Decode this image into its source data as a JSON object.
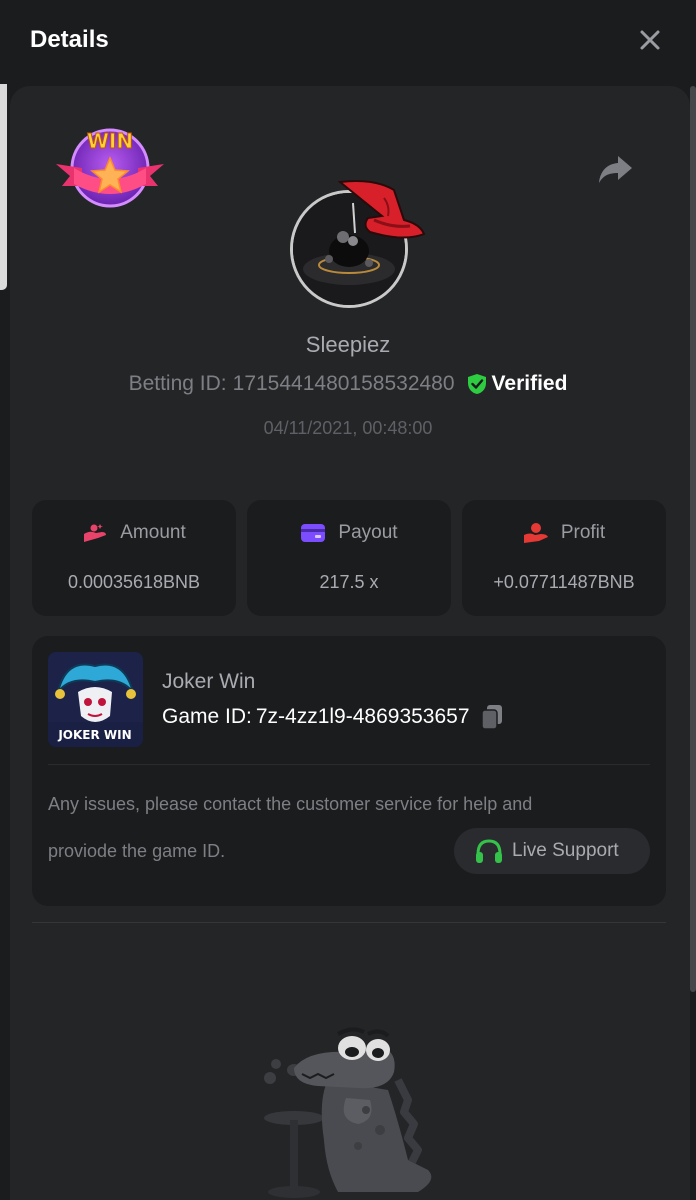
{
  "header": {
    "title": "Details"
  },
  "user": {
    "name": "Sleepiez",
    "betting_label": "Betting ID:",
    "betting_id": "1715441480158532480",
    "verified_label": "Verified",
    "datetime": "04/11/2021, 00:48:00"
  },
  "stats": {
    "amount": {
      "label": "Amount",
      "value": "0.00035618BNB"
    },
    "payout": {
      "label": "Payout",
      "value": "217.5 x"
    },
    "profit": {
      "label": "Profit",
      "value": "+0.07711487BNB"
    }
  },
  "game": {
    "name": "Joker Win",
    "id_label": "Game ID:",
    "id": "7z-4zz1l9-4869353657",
    "thumb_title": "JOKER WIN"
  },
  "support": {
    "message_line1": "Any issues, please contact the customer service for help and",
    "message_line2": "proviode the game ID.",
    "button_label": "Live Support"
  },
  "badge": {
    "text": "WIN"
  },
  "colors": {
    "background": "#1b1c1e",
    "panel": "#242527",
    "verified": "#2ecc40",
    "amount_icon": "#e8436a",
    "payout_icon": "#7b4dff",
    "profit_icon": "#e53935",
    "support_icon": "#35c24a"
  },
  "icons": {
    "close": "close-icon",
    "share": "share-icon",
    "verified": "shield-check-icon",
    "amount": "coins-hand-icon",
    "payout": "card-icon",
    "profit": "hand-coin-icon",
    "copy": "copy-icon",
    "support": "headset-icon"
  }
}
